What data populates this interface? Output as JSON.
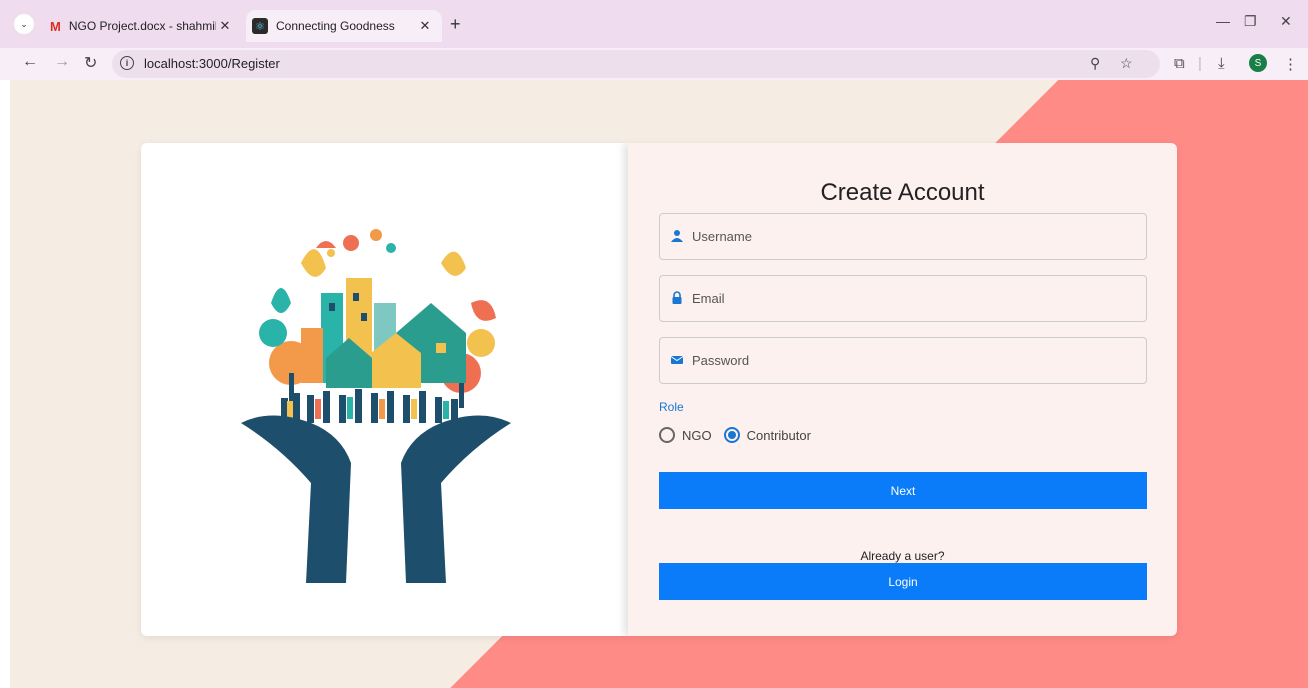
{
  "browser": {
    "tabs": [
      {
        "title": "NGO Project.docx - shahmiloni..."
      },
      {
        "title": "Connecting Goodness"
      }
    ],
    "address": "localhost:3000/Register",
    "avatar_letter": "S"
  },
  "form": {
    "title": "Create Account",
    "username_placeholder": "Username",
    "email_placeholder": "Email",
    "password_placeholder": "Password",
    "role_label": "Role",
    "role_options": [
      {
        "label": "NGO",
        "selected": false
      },
      {
        "label": "Contributor",
        "selected": true
      }
    ],
    "next_label": "Next",
    "already_text": "Already a user?",
    "login_label": "Login"
  },
  "colors": {
    "accent": "#0a7cfa",
    "page_beige": "#f5ede3",
    "page_coral": "#ff8b87",
    "hands": "#1d4e6b"
  }
}
